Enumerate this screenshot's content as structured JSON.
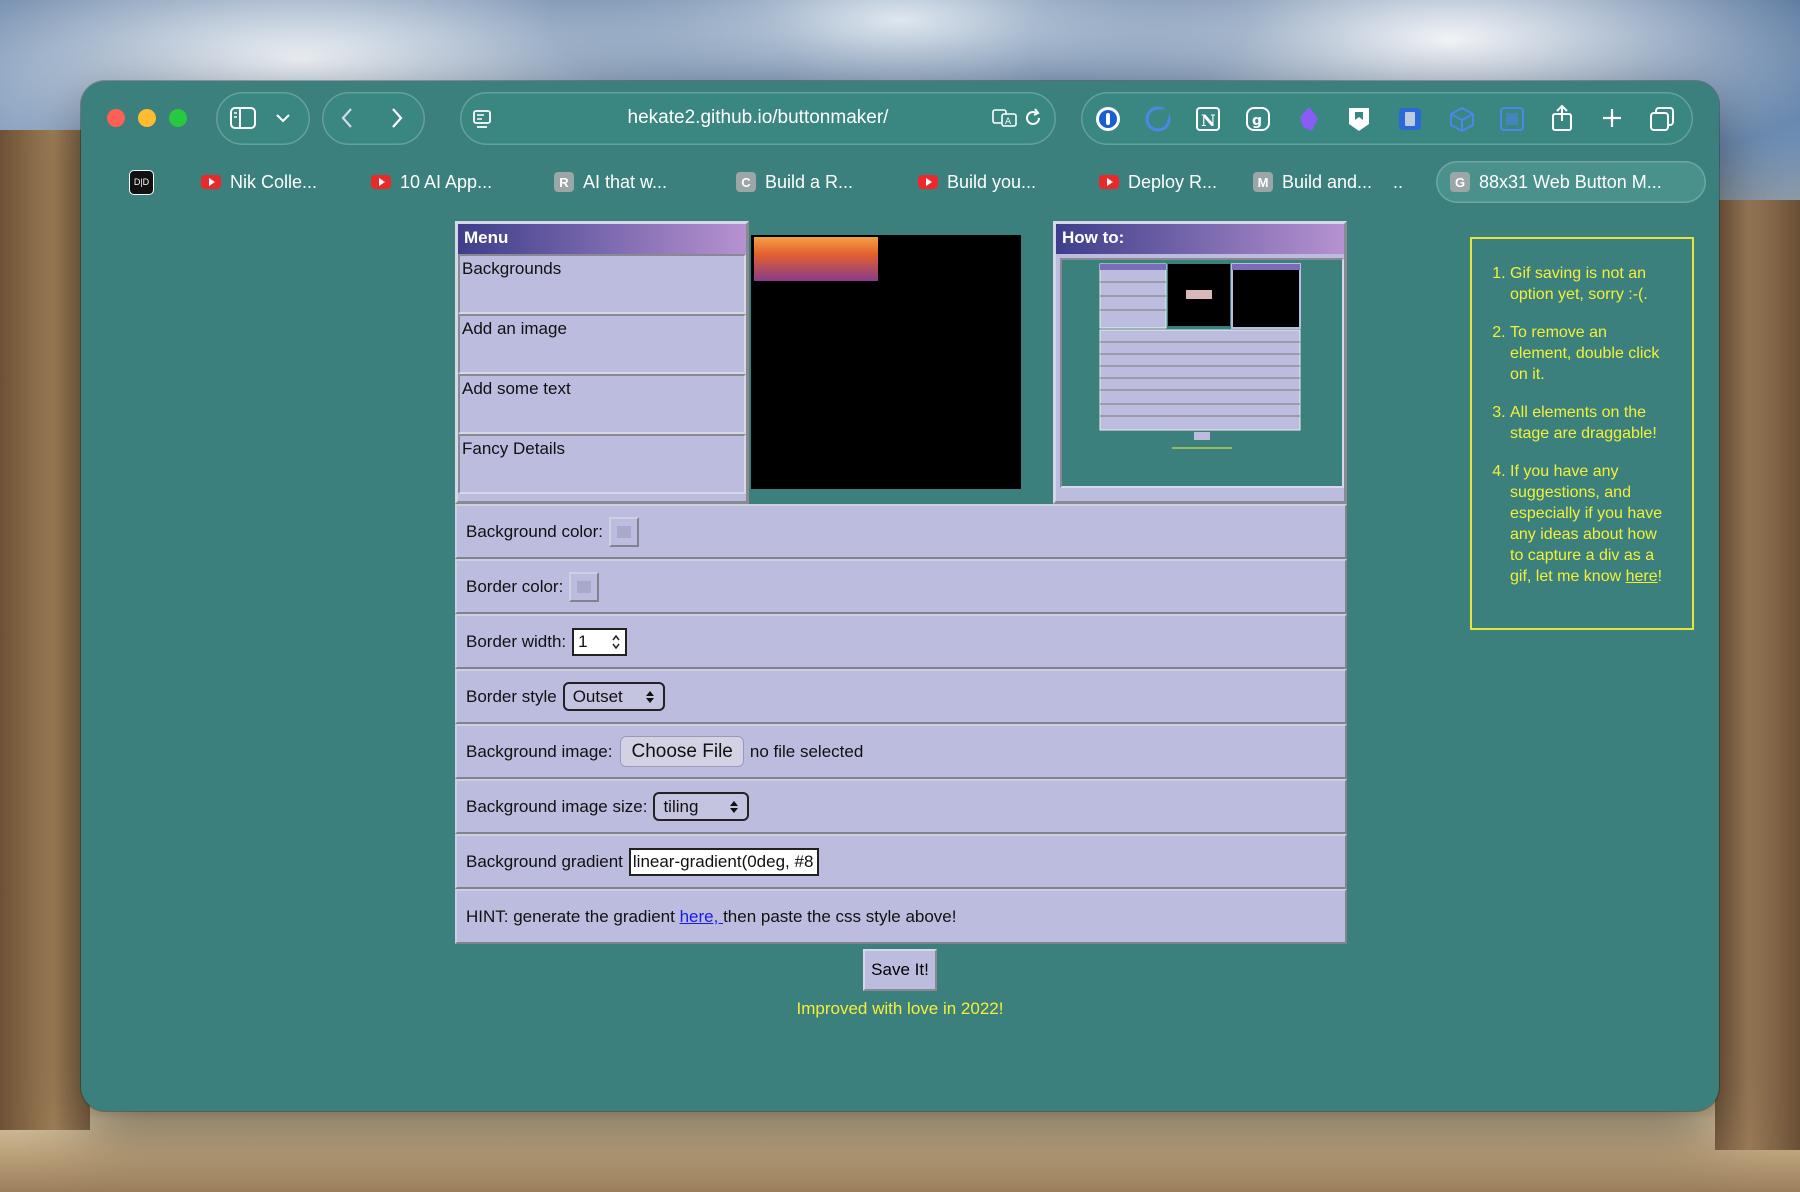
{
  "browser": {
    "url": "hekate2.github.io/buttonmaker/",
    "tabs": [
      {
        "label": "Nik Colle...",
        "type": "youtube"
      },
      {
        "label": "10 AI App...",
        "type": "youtube"
      },
      {
        "label": "AI that w...",
        "type": "letter",
        "letter": "R"
      },
      {
        "label": "Build a R...",
        "type": "letter",
        "letter": "C"
      },
      {
        "label": "Build you...",
        "type": "youtube"
      },
      {
        "label": "Deploy R...",
        "type": "youtube"
      },
      {
        "label": "Build and...",
        "type": "letter",
        "letter": "M"
      },
      {
        "label": "88x31 Web Button M...",
        "type": "letter",
        "letter": "G",
        "active": true
      }
    ],
    "tab_overflow": ".."
  },
  "menu": {
    "title": "Menu",
    "items": [
      "Backgrounds",
      "Add an image",
      "Add some text",
      "Fancy Details"
    ]
  },
  "howto_panel": {
    "title": "How to:"
  },
  "controls": {
    "bg_color_label": "Background color:",
    "border_color_label": "Border color:",
    "border_width_label": "Border width:",
    "border_width_value": "1",
    "border_style_label": "Border style",
    "border_style_value": "Outset",
    "bg_image_label": "Background image:",
    "choose_file": "Choose File",
    "no_file": "no file selected",
    "bg_image_size_label": "Background image size:",
    "bg_image_size_value": "tiling",
    "bg_gradient_label": "Background gradient",
    "bg_gradient_value": "linear-gradient(0deg, #8",
    "hint_prefix": "HINT: generate the gradient ",
    "hint_link": "here, ",
    "hint_suffix": "then paste the css style above!"
  },
  "save_label": "Save It!",
  "footer": "Improved with love in 2022!",
  "notes": [
    "Gif saving is not an option yet, sorry :-(.",
    "To remove an element, double click on it.",
    "All elements on the stage are draggable!",
    "If you have any suggestions, and especially if you have any ideas about how to capture a div as a gif, let me know "
  ],
  "notes_link": "here",
  "notes_link_suffix": "!",
  "colors": {
    "page_bg": "#3b807c",
    "panel": "#bcbcdf",
    "accent_text": "#f4ef3a",
    "header_start": "#3d3e8a",
    "header_end": "#b792d1"
  }
}
